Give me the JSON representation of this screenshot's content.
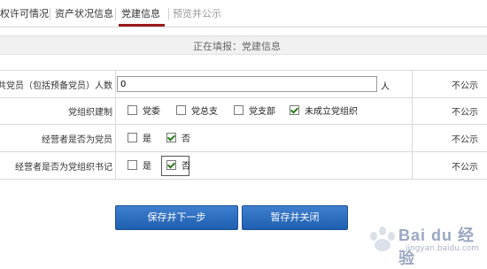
{
  "tabs": [
    {
      "label": "权许可情况"
    },
    {
      "label": "资产状况信息"
    },
    {
      "label": "党建信息"
    },
    {
      "label": "预览并公示"
    }
  ],
  "filling_status": "正在填报：党建信息",
  "rows": {
    "member_count": {
      "label": "共党员（包括预备党员）人数",
      "value": "0",
      "unit": "人",
      "status": "不公示"
    },
    "org_setup": {
      "label": "党组织建制",
      "options": [
        {
          "label": "党委",
          "checked": false
        },
        {
          "label": "党总支",
          "checked": false
        },
        {
          "label": "党支部",
          "checked": false
        },
        {
          "label": "未成立党组织",
          "checked": true
        }
      ],
      "status": "不公示"
    },
    "operator_member": {
      "label": "经营者是否为党员",
      "options": [
        {
          "label": "是",
          "checked": false
        },
        {
          "label": "否",
          "checked": true
        }
      ],
      "status": "不公示"
    },
    "operator_secretary": {
      "label": "经营者是否为党组织书记",
      "options": [
        {
          "label": "是",
          "checked": false
        },
        {
          "label": "否",
          "checked": true
        }
      ],
      "status": "不公示"
    }
  },
  "buttons": {
    "save_next": "保存并下一步",
    "save_close": "暂存并关闭"
  },
  "watermark": {
    "brand": "Bai du 经验",
    "sub": "jingyan.baidu.com"
  },
  "colors": {
    "tab_accent": "#9b1b1b",
    "button": "#2f6fc0",
    "checkmark": "#2e7d1f"
  }
}
